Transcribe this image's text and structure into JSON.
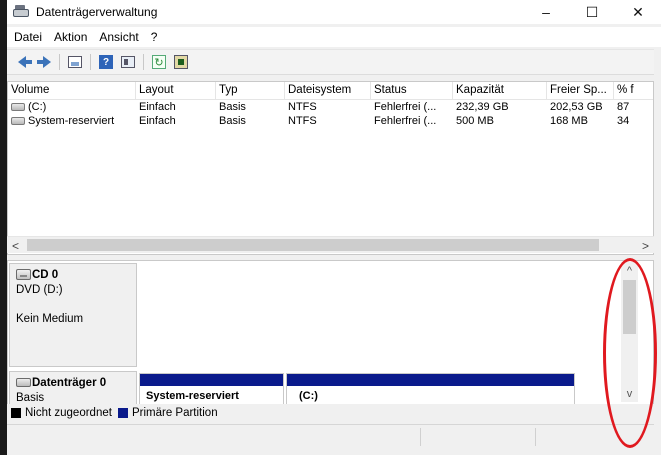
{
  "window": {
    "title": "Datenträgerverwaltung",
    "controls": {
      "minimize": "–",
      "maximize": "☐",
      "close": "✕"
    }
  },
  "menu": [
    "Datei",
    "Aktion",
    "Ansicht",
    "?"
  ],
  "toolbar": {
    "buttons": [
      "back-icon",
      "forward-icon",
      "show-panel-icon",
      "help-icon",
      "console-view-icon",
      "refresh-icon",
      "properties-icon"
    ]
  },
  "volume_list": {
    "columns": [
      "Volume",
      "Layout",
      "Typ",
      "Dateisystem",
      "Status",
      "Kapazität",
      "Freier Sp...",
      "% f"
    ],
    "rows": [
      [
        "(C:)",
        "Einfach",
        "Basis",
        "NTFS",
        "Fehlerfrei (...",
        "232,39 GB",
        "202,53 GB",
        "87"
      ],
      [
        "System-reserviert",
        "Einfach",
        "Basis",
        "NTFS",
        "Fehlerfrei (...",
        "500 MB",
        "168 MB",
        "34"
      ]
    ]
  },
  "scroll": {
    "left": "<",
    "right": ">",
    "up": "^",
    "down": "v"
  },
  "disks": {
    "cd": {
      "name": "CD 0",
      "type": "DVD (D:)",
      "status": "Kein Medium"
    },
    "disk0": {
      "name": "Datenträger 0",
      "type": "Basis",
      "partitions": [
        "System-reserviert",
        "(C:)"
      ]
    }
  },
  "legend": [
    {
      "label": "Nicht zugeordnet",
      "color": "#000000"
    },
    {
      "label": "Primäre Partition",
      "color": "#0a1a8c"
    }
  ],
  "colors": {
    "primary_partition": "#0a1a8c",
    "annotation": "#e0191f"
  }
}
